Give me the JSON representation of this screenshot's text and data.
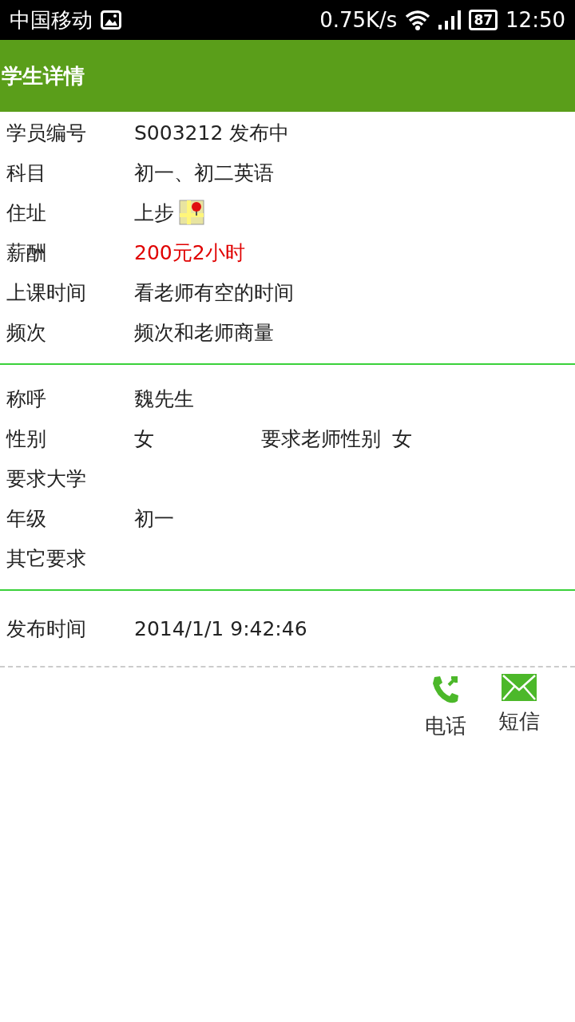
{
  "status_bar": {
    "carrier": "中国移动",
    "speed": "0.75K/s",
    "battery": "87",
    "time": "12:50"
  },
  "header": {
    "title": "学生详情"
  },
  "sections": [
    {
      "rows": [
        {
          "label": "学员编号",
          "value": "S003212 发布中",
          "kind": "text"
        },
        {
          "label": "科目",
          "value": "初一、初二英语",
          "kind": "text"
        },
        {
          "label": "住址",
          "value": "上步",
          "kind": "location"
        },
        {
          "label": "薪酬",
          "value": "200元2小时",
          "kind": "price"
        },
        {
          "label": "上课时间",
          "value": "看老师有空的时间",
          "kind": "text"
        },
        {
          "label": "频次",
          "value": "频次和老师商量",
          "kind": "text"
        }
      ]
    },
    {
      "rows": [
        {
          "label": "称呼",
          "value": "魏先生",
          "kind": "text"
        },
        {
          "label": "性别",
          "value": "女",
          "kind": "text",
          "extra_label": "要求老师性别",
          "extra_value": "女"
        },
        {
          "label": "要求大学",
          "kind": "text"
        },
        {
          "label": "年级",
          "value": "初一",
          "kind": "text"
        },
        {
          "label": "其它要求",
          "kind": "text"
        }
      ]
    },
    {
      "rows": [
        {
          "label": "发布时间",
          "value": "2014/1/1 9:42:46",
          "kind": "text"
        }
      ]
    }
  ],
  "actions": [
    {
      "label": "电话",
      "kind": "phone"
    },
    {
      "label": "短信",
      "kind": "sms"
    }
  ]
}
